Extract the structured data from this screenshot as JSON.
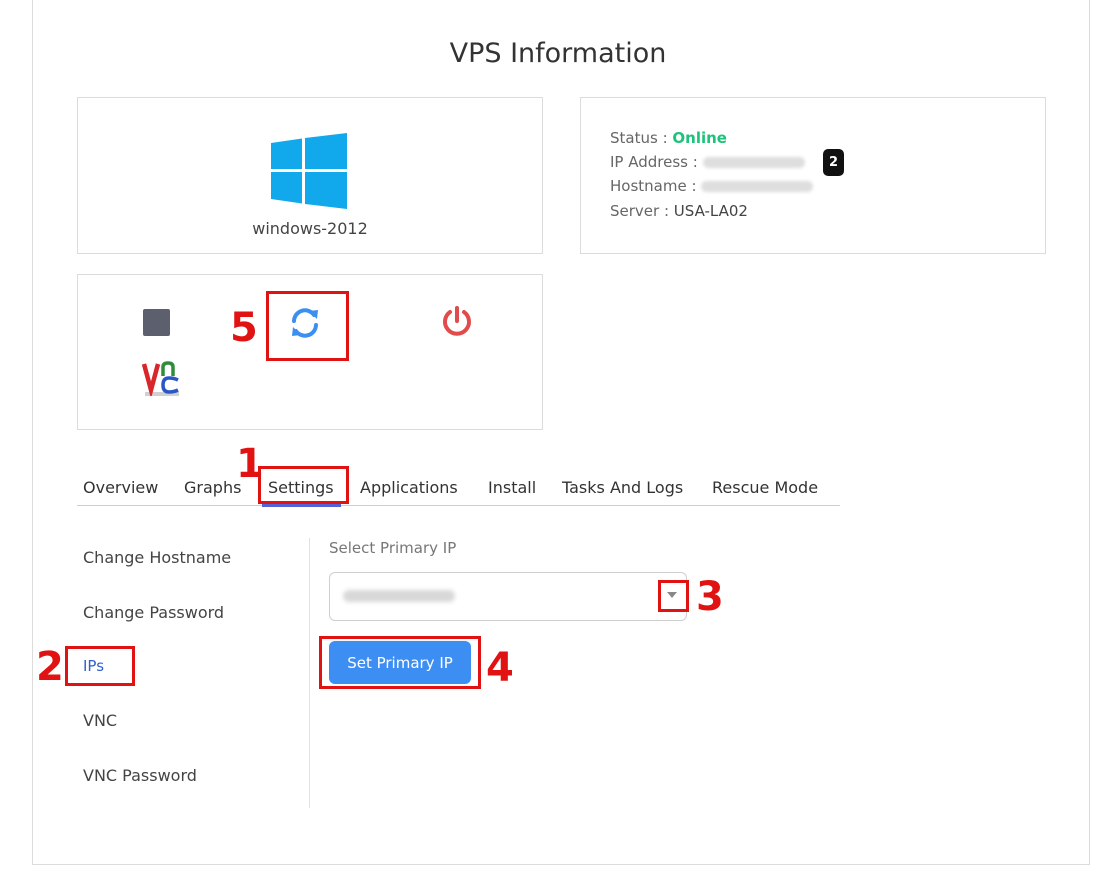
{
  "page": {
    "title": "VPS Information"
  },
  "os": {
    "name": "windows-2012",
    "icon": "windows-logo-icon"
  },
  "info": {
    "status_label": "Status :",
    "status_value": "Online",
    "ip_label": "IP Address :",
    "hostname_label": "Hostname :",
    "server_label": "Server :",
    "server_value": "USA-LA02"
  },
  "actions": {
    "stop_icon": "stop-icon",
    "reboot_icon": "refresh-icon",
    "power_icon": "power-icon",
    "vnc_icon": "vnc-icon"
  },
  "tabs": [
    {
      "label": "Overview"
    },
    {
      "label": "Graphs"
    },
    {
      "label": "Settings",
      "active": true
    },
    {
      "label": "Applications"
    },
    {
      "label": "Install"
    },
    {
      "label": "Tasks And Logs"
    },
    {
      "label": "Rescue Mode"
    }
  ],
  "settings_menu": [
    {
      "label": "Change Hostname"
    },
    {
      "label": "Change Password"
    },
    {
      "label": "IPs",
      "active": true
    },
    {
      "label": "VNC"
    },
    {
      "label": "VNC Password"
    }
  ],
  "ips_form": {
    "field_label": "Select Primary IP",
    "submit_label": "Set Primary IP"
  },
  "annotations": [
    "1",
    "2",
    "3",
    "4",
    "5"
  ],
  "badge": "2",
  "colors": {
    "status_online": "#1ec27a",
    "primary_button": "#3d8ef2",
    "annotation_red": "#e01212",
    "active_link": "#2f5fd0",
    "tab_underline": "#5561d8"
  }
}
